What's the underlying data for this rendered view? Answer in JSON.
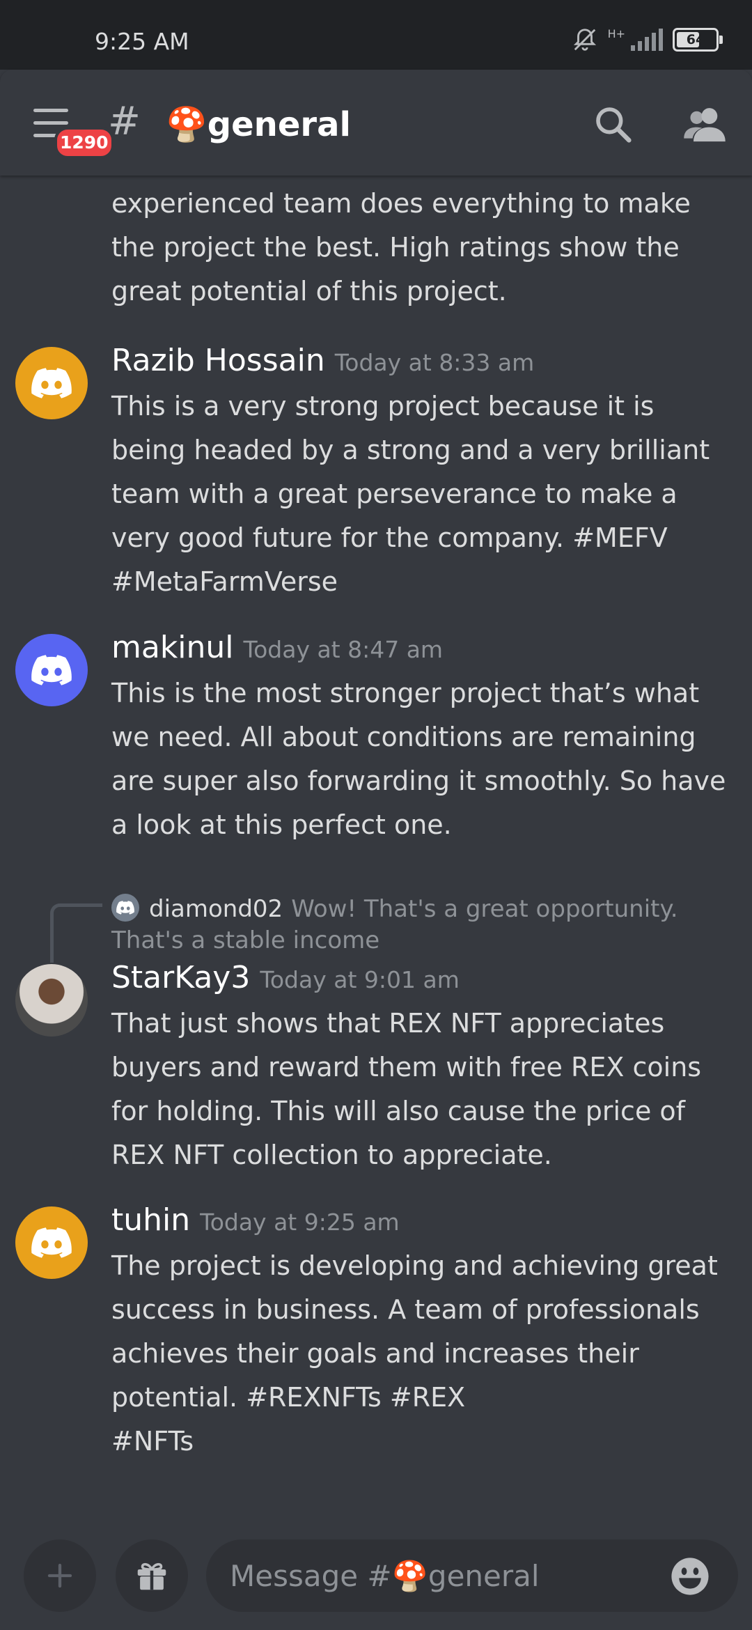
{
  "status": {
    "time": "9:25 AM",
    "network": "H+",
    "battery": "64",
    "battery_level": 0.64
  },
  "header": {
    "badge": "1290",
    "hash": "#",
    "channel": "🍄general"
  },
  "messages": [
    {
      "id": "partial",
      "body": "REX NFT project is growing very fast. An experienced team does everything to make the project the best. High ratings show the great potential of this project."
    },
    {
      "id": "m1",
      "author": "Razib Hossain",
      "time": "Today at 8:33 am",
      "avatar": "orange",
      "body": "This is a very strong project because it is being headed by a strong and a very brilliant team with a great perseverance to make a very good future for the company. #MEFV #MetaFarmVerse"
    },
    {
      "id": "m2",
      "author": "makinul",
      "time": "Today at 8:47 am",
      "avatar": "blurple",
      "body": "This is the most stronger project that’s what we need. All about conditions are remaining are super also forwarding it smoothly. So have a look at this perfect one."
    },
    {
      "id": "m3",
      "reply": {
        "author": "diamond02",
        "text": "Wow! That's a great opportunity.",
        "text_cont": "That's a stable income"
      },
      "author": "StarKay3",
      "time": "Today at 9:01 am",
      "avatar": "photo",
      "body": "That just shows that REX NFT appreciates buyers and reward them with free REX coins for holding. This will also cause the price of REX NFT collection to appreciate."
    },
    {
      "id": "m4",
      "author": "tuhin",
      "time": "Today at 9:25 am",
      "avatar": "orange",
      "body_lines": [
        "The project is developing and achieving great success in business. A team of professionals achieves their goals and increases their potential. #REXNFTs #REX",
        "#NFTs"
      ]
    }
  ],
  "composer": {
    "placeholder": "Message #🍄general"
  },
  "colors": {
    "background": "#36393f",
    "statusbar": "#202225",
    "orange_avatar": "#e9a11b",
    "blurple_avatar": "#5865f2",
    "badge": "#ed4245"
  },
  "icons": [
    "menu-icon",
    "search-icon",
    "members-icon",
    "discord-logo-icon",
    "plus-icon",
    "gift-icon",
    "emoji-icon",
    "bell-off-icon"
  ]
}
